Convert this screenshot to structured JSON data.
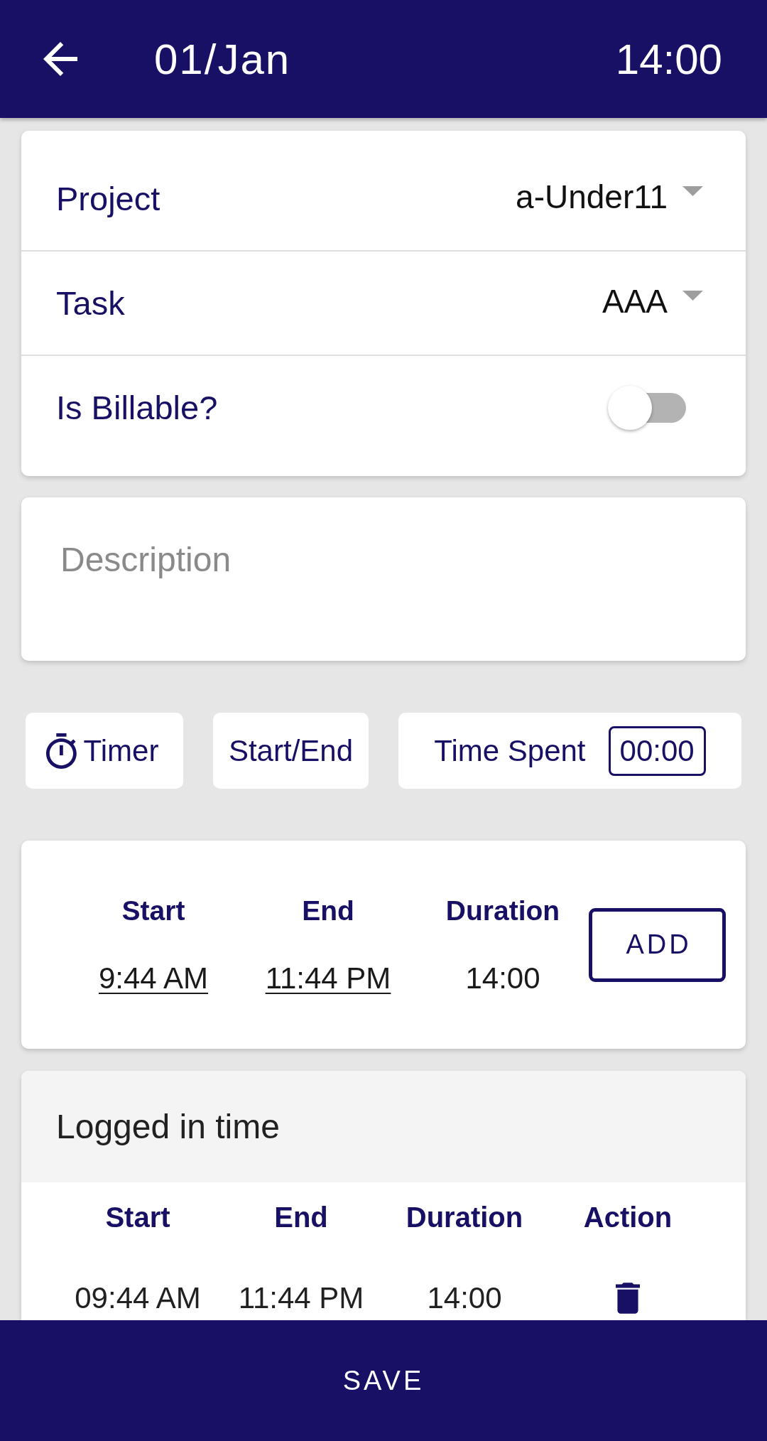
{
  "app_bar": {
    "title": "01/Jan",
    "total": "14:00"
  },
  "details": {
    "fields": [
      {
        "kind": "dropdown",
        "label": "Project",
        "value": "a-Under11"
      },
      {
        "kind": "dropdown",
        "label": "Task",
        "value": "AAA"
      },
      {
        "kind": "toggle",
        "label": "Is Billable?",
        "on": false
      }
    ]
  },
  "description": {
    "placeholder": "Description"
  },
  "modes": [
    {
      "kind": "timer",
      "label": "Timer"
    },
    {
      "kind": "range",
      "label": "Start/End"
    },
    {
      "kind": "spent",
      "label": "Time Spent",
      "value": "00:00"
    }
  ],
  "entry": {
    "columns": [
      "Start",
      "End",
      "Duration"
    ],
    "start": "9:44 AM",
    "end": "11:44 PM",
    "duration": "14:00",
    "button": "ADD"
  },
  "logged": {
    "title": "Logged in time",
    "columns": [
      "Start",
      "End",
      "Duration",
      "Action"
    ],
    "rows": [
      {
        "start": "09:44 AM",
        "end": "11:44 PM",
        "duration": "14:00"
      }
    ]
  },
  "save_button": "SAVE"
}
